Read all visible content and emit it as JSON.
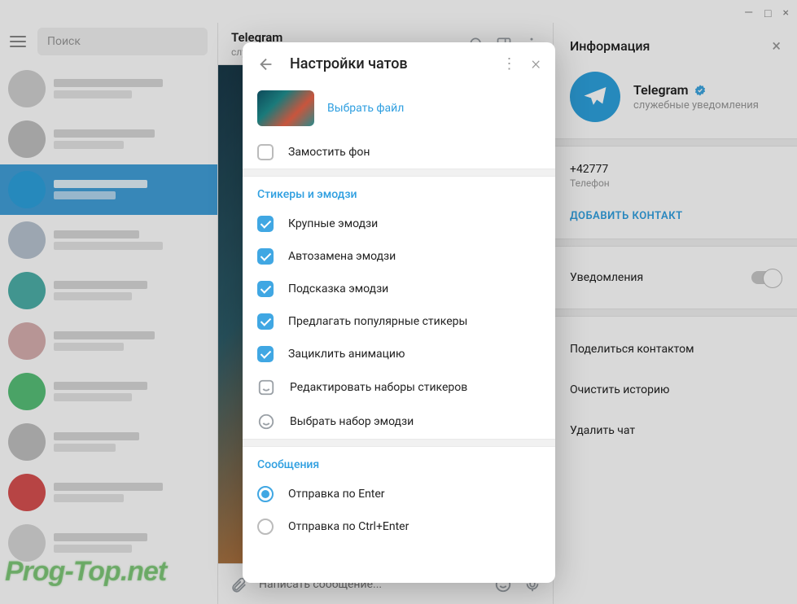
{
  "window": {
    "minimize": "—",
    "maximize": "□",
    "close": "×"
  },
  "sidebar": {
    "search_placeholder": "Поиск"
  },
  "chat_header": {
    "title": "Telegram",
    "subtitle": "слу"
  },
  "chat_input": {
    "placeholder": "Написать сообщение..."
  },
  "info": {
    "title": "Информация",
    "name": "Telegram",
    "subtitle": "служебные уведомления",
    "phone": "+42777",
    "phone_label": "Телефон",
    "add_contact": "ДОБАВИТЬ КОНТАКТ",
    "notifications": "Уведомления",
    "share": "Поделиться контактом",
    "clear": "Очистить историю",
    "delete": "Удалить чат"
  },
  "dialog": {
    "title": "Настройки чатов",
    "bg_select": "Выбрать файл",
    "tile_bg": "Замостить фон",
    "section_stickers": "Стикеры и эмодзи",
    "big_emoji": "Крупные эмодзи",
    "autoreplace": "Автозамена эмодзи",
    "suggest_emoji": "Подсказка эмодзи",
    "suggest_popular": "Предлагать популярные стикеры",
    "loop_anim": "Зациклить анимацию",
    "edit_sets": "Редактировать наборы стикеров",
    "choose_set": "Выбрать набор эмодзи",
    "section_messages": "Сообщения",
    "send_enter": "Отправка по Enter",
    "send_ctrl_enter": "Отправка по Ctrl+Enter"
  },
  "watermark": "Prog-Top.net"
}
